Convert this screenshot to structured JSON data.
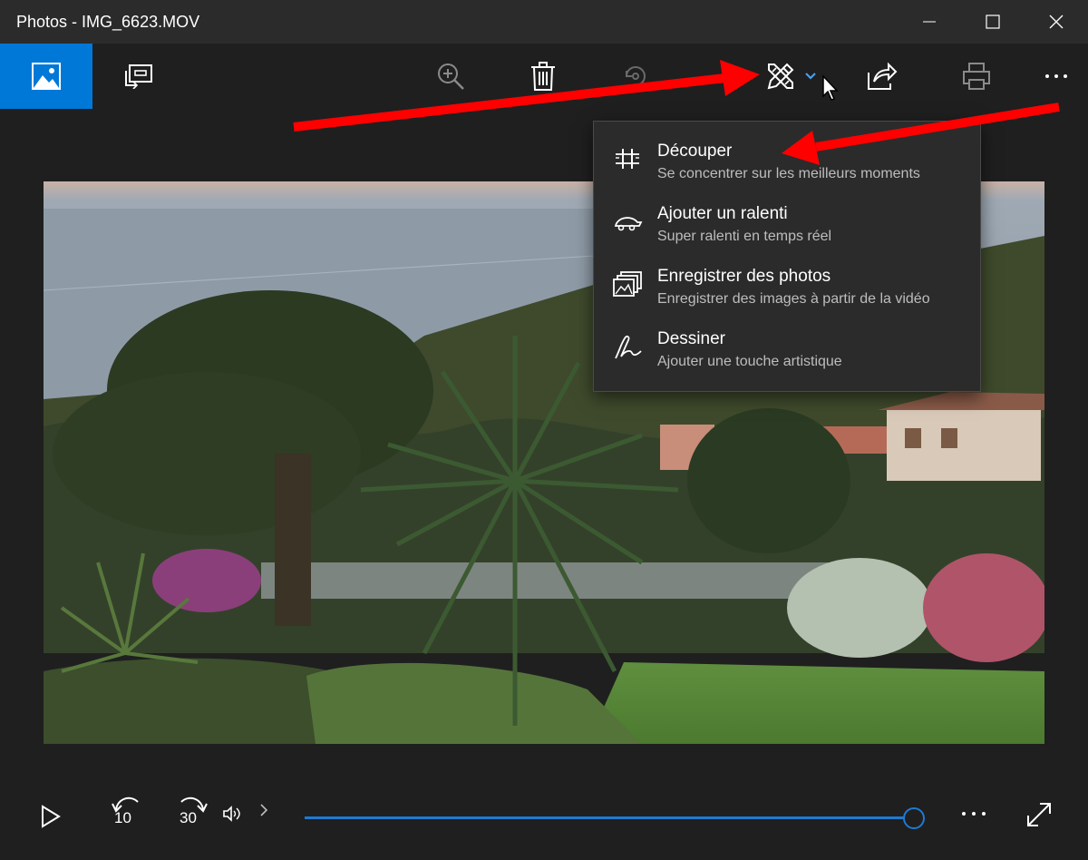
{
  "window": {
    "title": "Photos - IMG_6623.MOV"
  },
  "colors": {
    "accent": "#0078d7",
    "background": "#1f1f1f",
    "menu_bg": "#2b2b2b",
    "seek": "#1e7ad2",
    "annotation_arrow": "#ff0000"
  },
  "toolbar": {
    "items": [
      {
        "name": "home-icon"
      },
      {
        "name": "slideshow-icon"
      },
      {
        "name": "zoom-in-icon"
      },
      {
        "name": "delete-icon"
      },
      {
        "name": "rotate-icon"
      },
      {
        "name": "edit-create-icon"
      },
      {
        "name": "chevron-down-icon"
      },
      {
        "name": "share-icon"
      },
      {
        "name": "print-icon"
      },
      {
        "name": "more-icon"
      }
    ]
  },
  "menu": {
    "items": [
      {
        "title": "Découper",
        "subtitle": "Se concentrer sur les meilleurs moments",
        "icon": "trim-icon"
      },
      {
        "title": "Ajouter un ralenti",
        "subtitle": "Super ralenti en temps réel",
        "icon": "slow-motion-icon"
      },
      {
        "title": "Enregistrer des photos",
        "subtitle": "Enregistrer des images à partir de la vidéo",
        "icon": "save-photos-icon"
      },
      {
        "title": "Dessiner",
        "subtitle": "Ajouter une touche artistique",
        "icon": "draw-icon"
      }
    ]
  },
  "controls": {
    "skip_back": "10",
    "skip_forward": "30",
    "progress": 0.998
  }
}
